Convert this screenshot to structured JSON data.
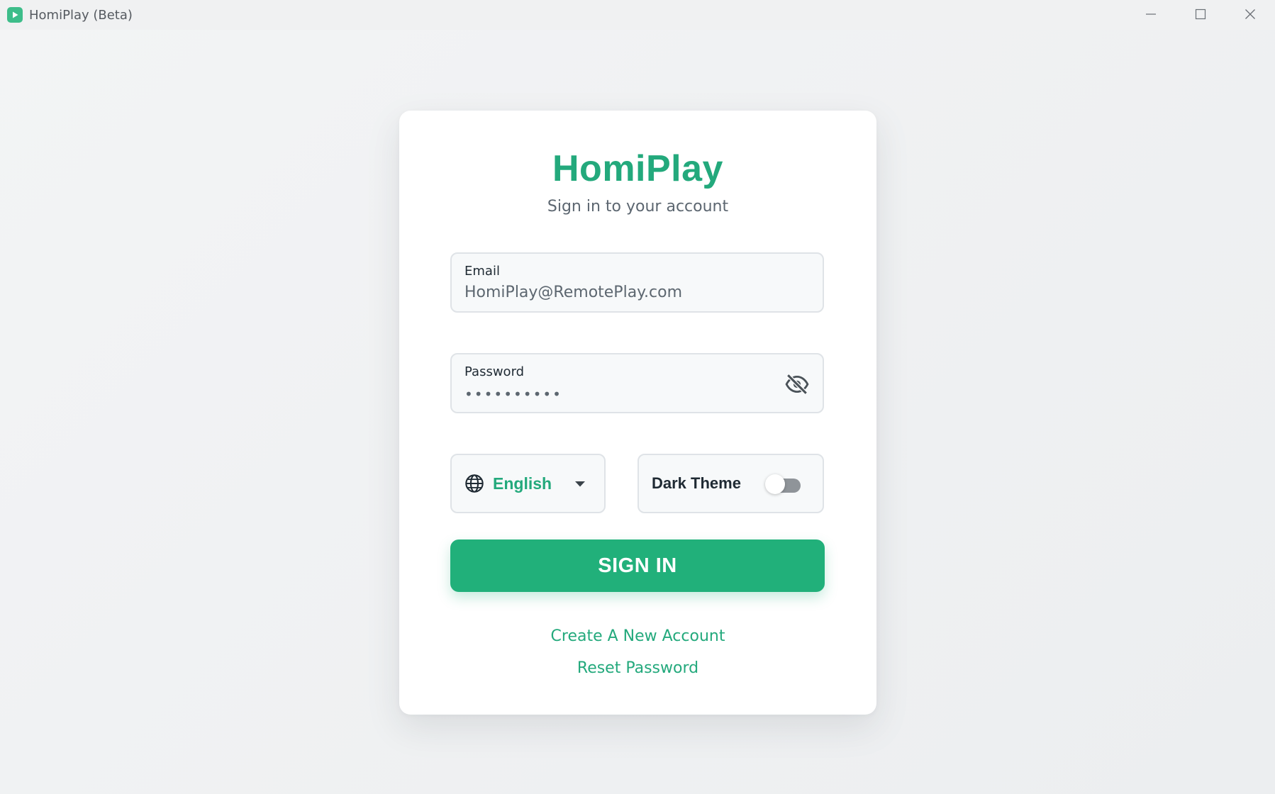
{
  "window": {
    "title": "HomiPlay (Beta)",
    "icon": "play-icon",
    "controls": [
      "minimize-icon",
      "maximize-icon",
      "close-icon"
    ]
  },
  "login": {
    "brand": "HomiPlay",
    "subtitle": "Sign in to your account",
    "email": {
      "label": "Email",
      "value": "HomiPlay@RemotePlay.com"
    },
    "password": {
      "label": "Password",
      "masked_value": "••••••••••",
      "visibility_icon": "eye-off-icon"
    },
    "language": {
      "icon": "globe-icon",
      "selected": "English"
    },
    "theme": {
      "label": "Dark Theme",
      "enabled": false
    },
    "sign_in_label": "SIGN IN",
    "create_account_link": "Create A New Account",
    "reset_password_link": "Reset Password"
  },
  "colors": {
    "accent": "#21b07a",
    "text_dark": "#1f2a33",
    "text_muted": "#5c6670",
    "field_border": "#dfe3e7",
    "field_bg": "#f7f9fa"
  }
}
